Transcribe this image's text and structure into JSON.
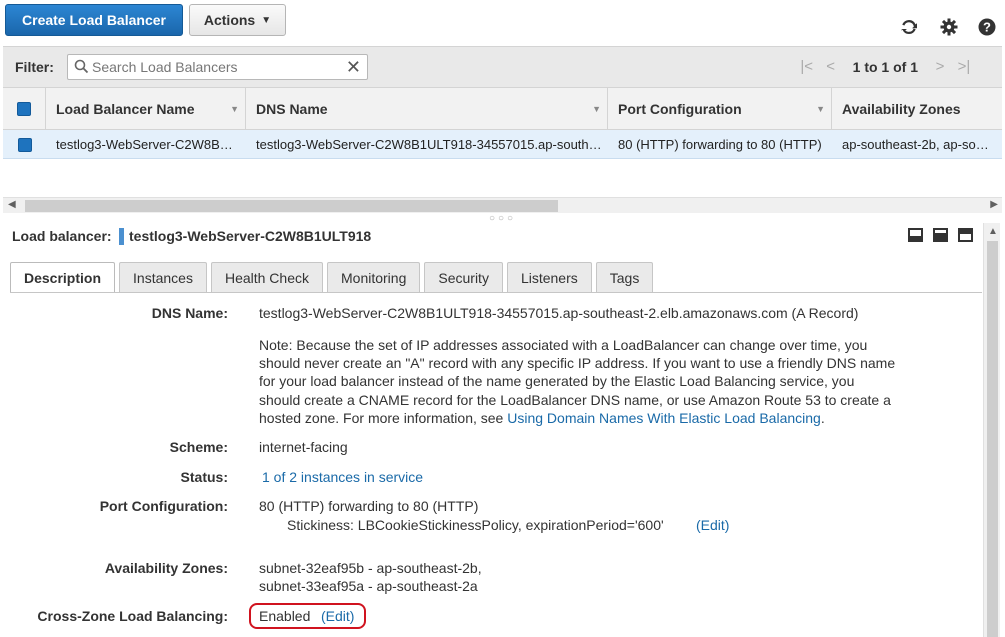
{
  "toolbar": {
    "create_label": "Create Load Balancer",
    "actions_label": "Actions",
    "icons": [
      "refresh-icon",
      "gear-icon",
      "help-icon"
    ]
  },
  "filter": {
    "label": "Filter:",
    "placeholder": "Search Load Balancers",
    "clear_glyph": "✕"
  },
  "pager": {
    "text": "1 to 1 of 1"
  },
  "table": {
    "columns": [
      "Load Balancer Name",
      "DNS Name",
      "Port Configuration",
      "Availability Zones"
    ],
    "rows": [
      {
        "name": "testlog3-WebServer-C2W8B…",
        "dns": "testlog3-WebServer-C2W8B1ULT918-34557015.ap-south…",
        "port": "80 (HTTP) forwarding to 80 (HTTP)",
        "zones": "ap-southeast-2b, ap-so…"
      }
    ]
  },
  "detail": {
    "lb_label": "Load balancer:",
    "lb_name": "testlog3-WebServer-C2W8B1ULT918",
    "tabs": [
      "Description",
      "Instances",
      "Health Check",
      "Monitoring",
      "Security",
      "Listeners",
      "Tags"
    ],
    "active_tab": "Description",
    "fields": {
      "dns_label": "DNS Name:",
      "dns_value": "testlog3-WebServer-C2W8B1ULT918-34557015.ap-southeast-2.elb.amazonaws.com (A Record)",
      "note_text": "Note: Because the set of IP addresses associated with a LoadBalancer can change over time, you should never create an \"A\" record with any specific IP address. If you want to use a friendly DNS name for your load balancer instead of the name generated by the Elastic Load Balancing service, you should create a CNAME record for the LoadBalancer DNS name, or use Amazon Route 53 to create a hosted zone. For more information, see",
      "note_link": "Using Domain Names With Elastic Load Balancing",
      "note_end": ".",
      "scheme_label": "Scheme:",
      "scheme_value": "internet-facing",
      "status_label": "Status:",
      "status_value": "1 of 2 instances in service",
      "port_label": "Port Configuration:",
      "port_value": "80 (HTTP) forwarding to 80 (HTTP)",
      "stickiness_value": "Stickiness: LBCookieStickinessPolicy, expirationPeriod='600'",
      "stickiness_edit": "(Edit)",
      "az_label": "Availability Zones:",
      "az_value_1": "subnet-32eaf95b - ap-southeast-2b,",
      "az_value_2": "subnet-33eaf95a - ap-southeast-2a",
      "cz_label": "Cross-Zone Load Balancing:",
      "cz_value": "Enabled",
      "cz_edit": "(Edit)"
    }
  },
  "colors": {
    "primary": "#1e73be",
    "link": "#1a6aa8",
    "highlight": "#d0131f",
    "row_selected": "#e4f0fb"
  }
}
